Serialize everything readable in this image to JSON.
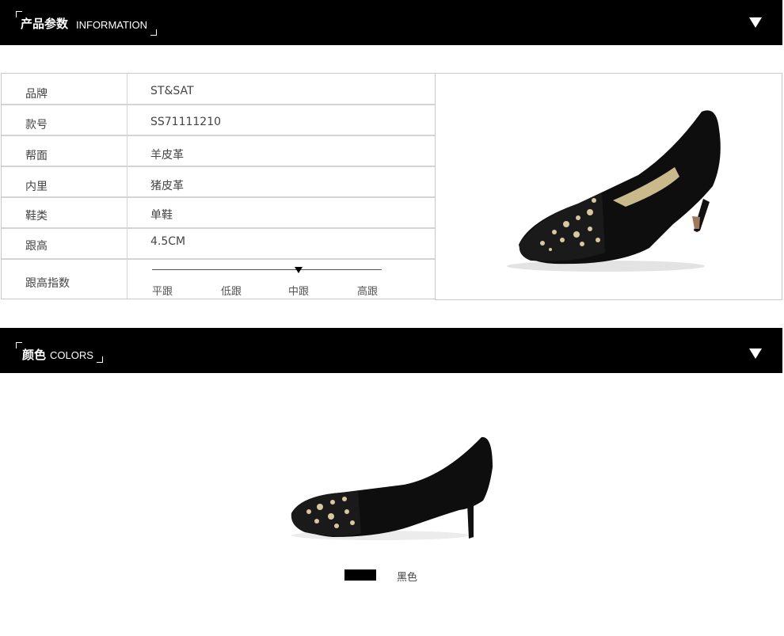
{
  "sections": {
    "info": {
      "title_cn": "产品参数",
      "title_en": "INFORMATION"
    },
    "colors": {
      "title_cn": "颜色",
      "title_en": "COLORS"
    }
  },
  "specs": [
    {
      "label": "品牌",
      "value": "ST&SAT"
    },
    {
      "label": "款号",
      "value": "SS71111210"
    },
    {
      "label": "帮面",
      "value": "羊皮革"
    },
    {
      "label": "内里",
      "value": "猪皮革"
    },
    {
      "label": "鞋类",
      "value": "单鞋"
    },
    {
      "label": "跟高",
      "value": "4.5CM"
    },
    {
      "label": "跟高指数"
    }
  ],
  "heel_index": {
    "levels": [
      "平跟",
      "低跟",
      "中跟",
      "高跟"
    ],
    "selected": "中跟"
  },
  "color_option": {
    "name": "黑色",
    "hex": "#000000"
  },
  "icons": {
    "toggle": "triangle-down-icon"
  }
}
